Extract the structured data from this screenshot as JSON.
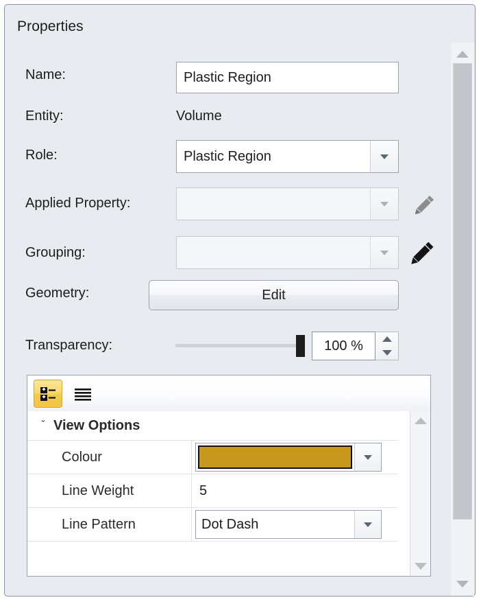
{
  "panel": {
    "title": "Properties"
  },
  "fields": {
    "name": {
      "label": "Name:",
      "value": "Plastic Region",
      "placeholder": ""
    },
    "entity": {
      "label": "Entity:",
      "value": "Volume"
    },
    "role": {
      "label": "Role:",
      "value": "Plastic Region"
    },
    "applied_property": {
      "label": "Applied Property:",
      "value": "",
      "edit_icon": "pencil-icon"
    },
    "grouping": {
      "label": "Grouping:",
      "value": "",
      "edit_icon": "pencil-icon"
    },
    "geometry": {
      "label": "Geometry:",
      "button_label": "Edit"
    },
    "transparency": {
      "label": "Transparency:",
      "value": "100 %",
      "percent": 100
    }
  },
  "grid": {
    "toolbar": {
      "categorized_icon": "categorized-view-icon",
      "alphabetical_icon": "alphabetical-view-icon",
      "categorized_active": true
    },
    "category": {
      "label": "View Options",
      "chevron": "ˇ",
      "expanded": true
    },
    "rows": [
      {
        "name": "Colour",
        "value": "",
        "editor": "colour",
        "swatch": "#C9991E"
      },
      {
        "name": "Line Weight",
        "value": "5",
        "editor": "text"
      },
      {
        "name": "Line Pattern",
        "value": "Dot Dash",
        "editor": "combo"
      }
    ]
  },
  "colors": {
    "panel_bg": "#E8EBF0",
    "swatch": "#C9991E",
    "toolbar_active": "#F6D469",
    "field_border": "#9AA2AD"
  }
}
